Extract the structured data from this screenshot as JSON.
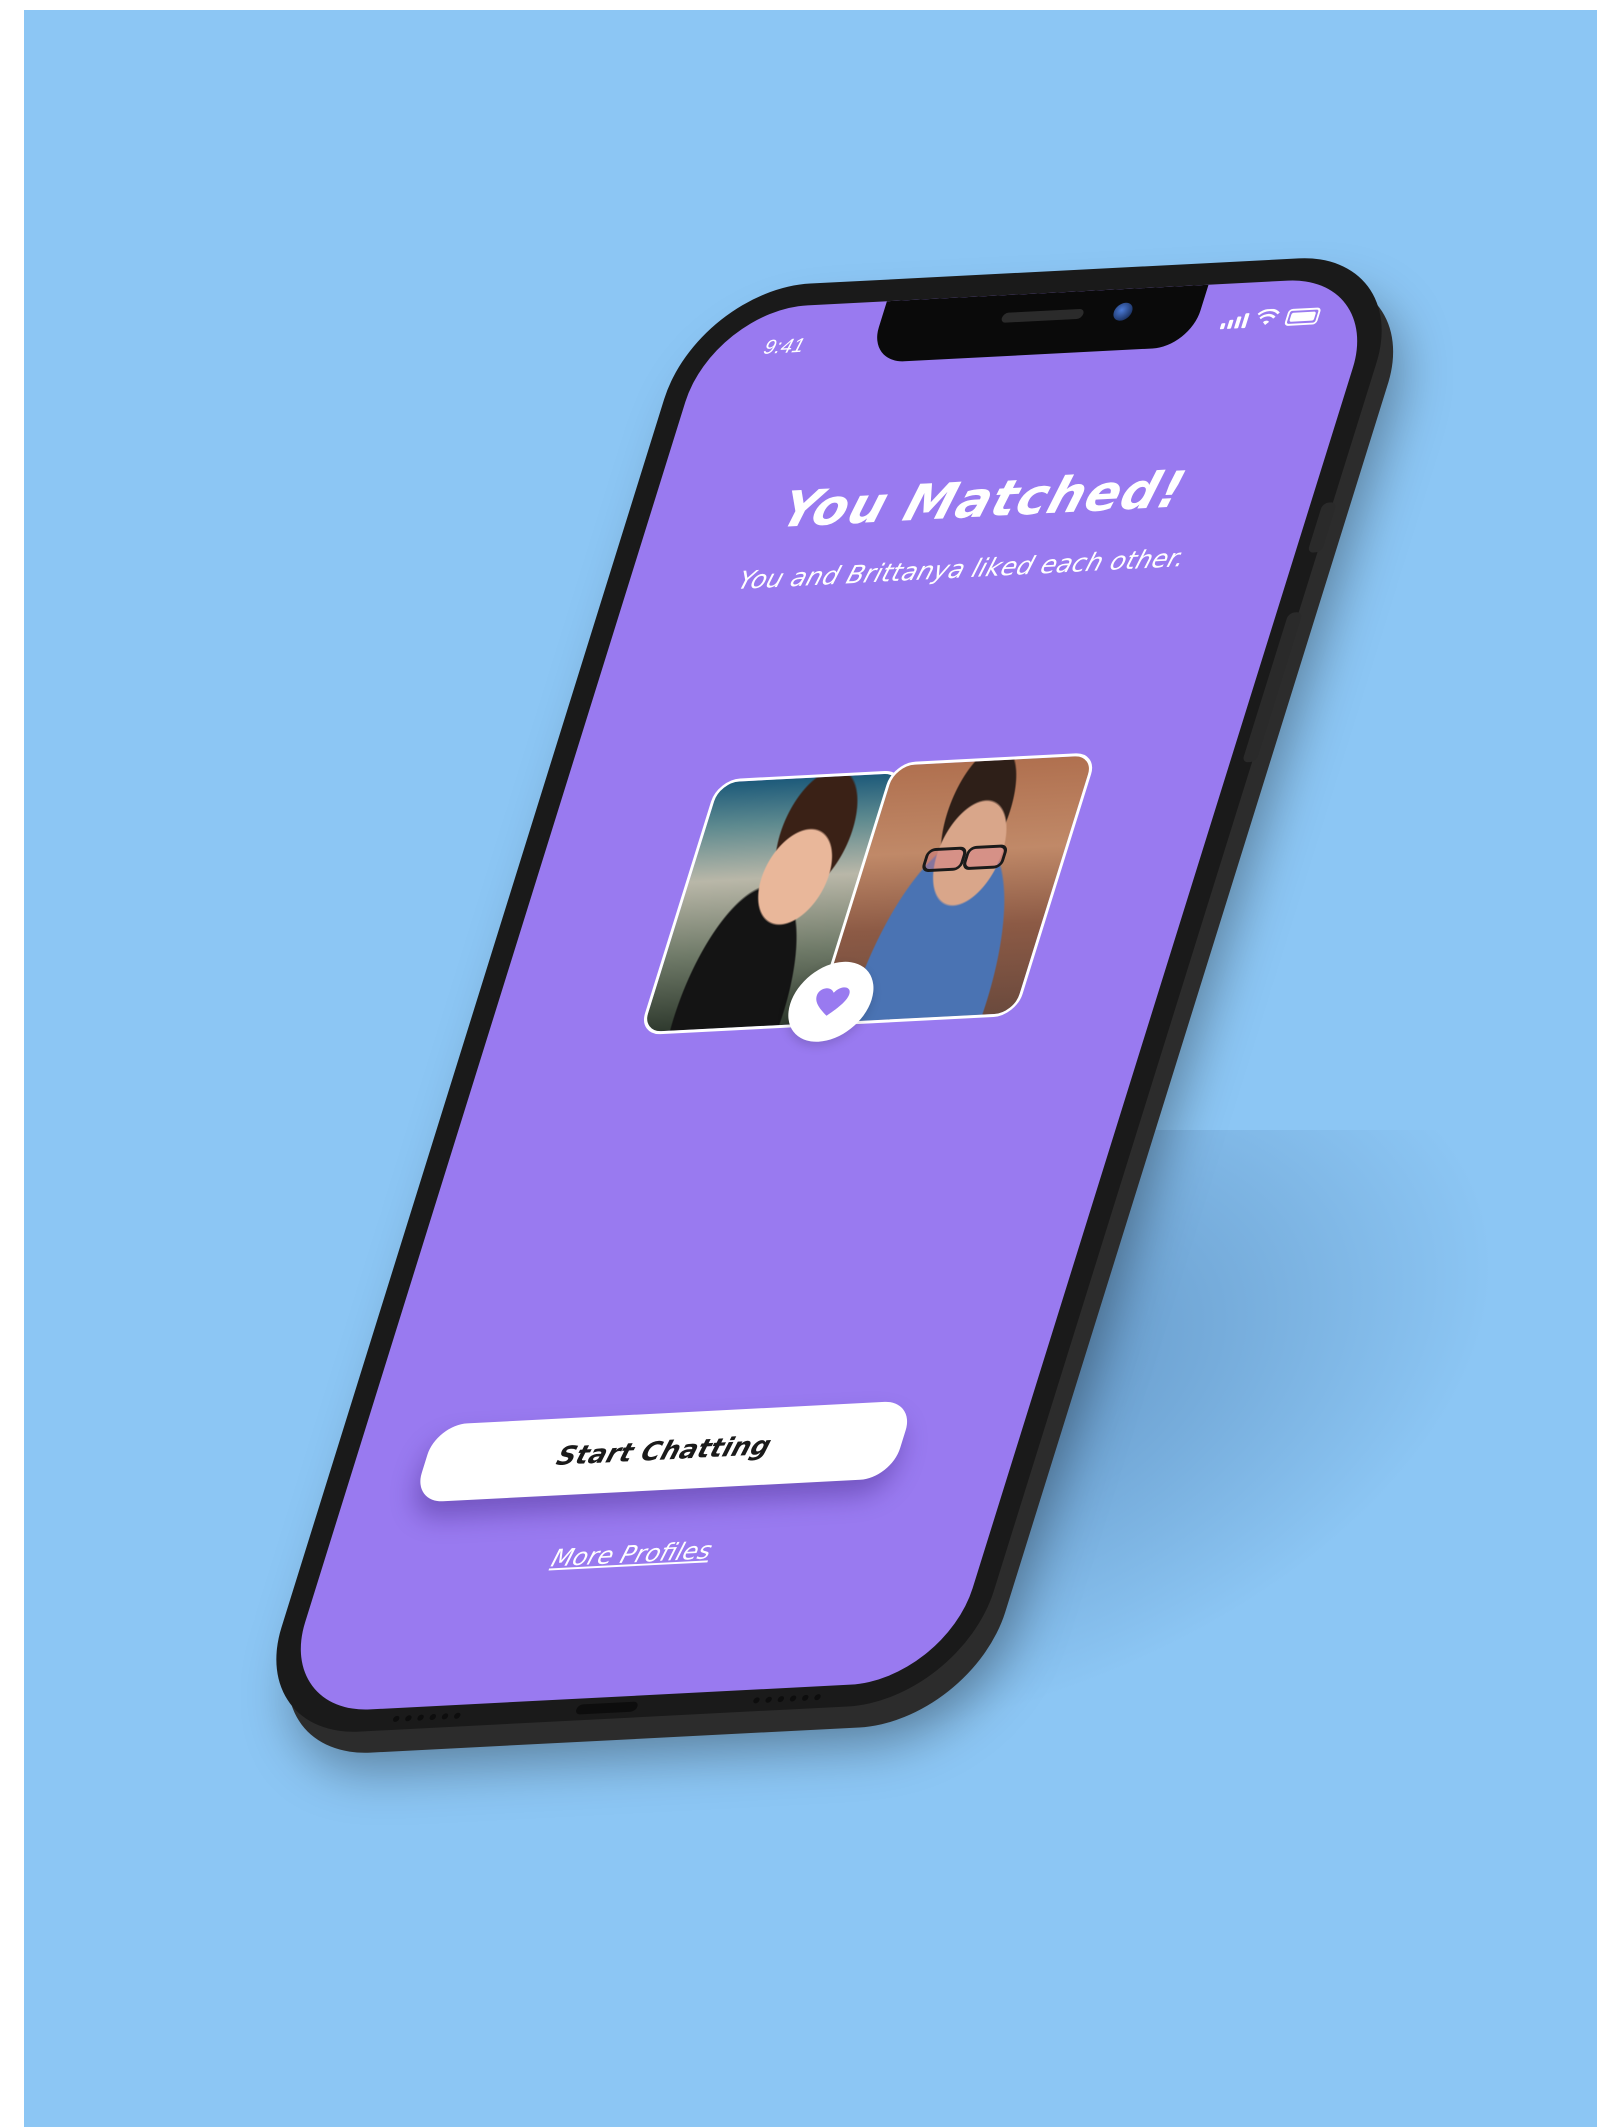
{
  "colors": {
    "background": "#8cc6f4",
    "screen": "#997af0",
    "button": "#ffffff",
    "heart": "#997af0"
  },
  "status_bar": {
    "time": "9:41",
    "icons": [
      "signal-icon",
      "wifi-icon",
      "battery-icon"
    ]
  },
  "match_screen": {
    "title": "You Matched!",
    "subtitle": "You and Brittanya liked each other.",
    "photos": [
      "photo-brittanya",
      "photo-user"
    ],
    "badge_icon": "heart-icon",
    "primary_button": "Start Chatting",
    "secondary_link": "More Profiles"
  }
}
